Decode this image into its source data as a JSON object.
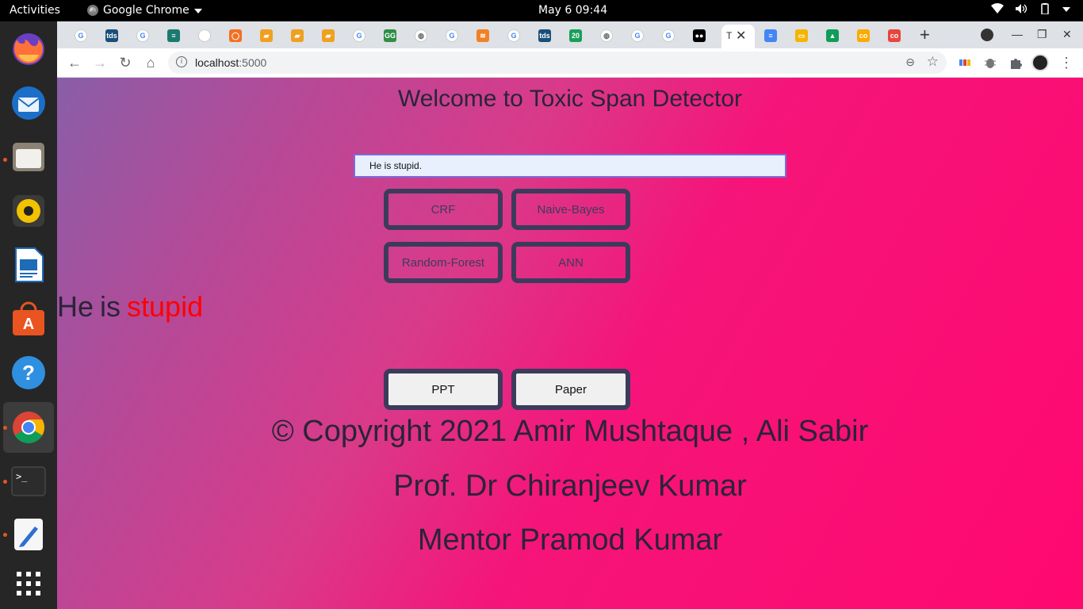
{
  "topbar": {
    "activities": "Activities",
    "app_name": "Google Chrome",
    "clock": "May 6  09:44"
  },
  "dock": {
    "items": [
      "firefox-icon",
      "thunderbird-icon",
      "files-icon",
      "rhythmbox-icon",
      "libreoffice-writer-icon",
      "software-icon",
      "help-icon",
      "chrome-icon",
      "terminal-icon",
      "text-editor-icon",
      "app-grid-icon"
    ]
  },
  "browser": {
    "tabs": [
      {
        "icon": "google",
        "color": "#4285f4",
        "label": "G"
      },
      {
        "icon": "tds",
        "color": "#1a4e7a",
        "label": "tds"
      },
      {
        "icon": "google",
        "color": "#4285f4",
        "label": "G"
      },
      {
        "icon": "table",
        "color": "#1a7a6e",
        "label": "≡"
      },
      {
        "icon": "wikipedia",
        "color": "#ffffff",
        "label": "W"
      },
      {
        "icon": "ring",
        "color": "#f37021",
        "label": "◯"
      },
      {
        "icon": "book",
        "color": "#f0a020",
        "label": "▰"
      },
      {
        "icon": "book",
        "color": "#f0a020",
        "label": "▰"
      },
      {
        "icon": "book",
        "color": "#f0a020",
        "label": "▰"
      },
      {
        "icon": "google",
        "color": "#4285f4",
        "label": "G"
      },
      {
        "icon": "gfg",
        "color": "#2f8d46",
        "label": "GG"
      },
      {
        "icon": "globe",
        "color": "#5f6368",
        "label": "◍"
      },
      {
        "icon": "google",
        "color": "#4285f4",
        "label": "G"
      },
      {
        "icon": "stack",
        "color": "#f48024",
        "label": "≋"
      },
      {
        "icon": "google",
        "color": "#4285f4",
        "label": "G"
      },
      {
        "icon": "tds",
        "color": "#1a4e7a",
        "label": "tds"
      },
      {
        "icon": "twenty",
        "color": "#18a058",
        "label": "20"
      },
      {
        "icon": "globe",
        "color": "#5f6368",
        "label": "◍"
      },
      {
        "icon": "google",
        "color": "#4285f4",
        "label": "G"
      },
      {
        "icon": "google",
        "color": "#4285f4",
        "label": "G"
      },
      {
        "icon": "medium",
        "color": "#000000",
        "label": "●●"
      }
    ],
    "active_tab_label": "T",
    "after_tabs": [
      {
        "icon": "docs",
        "color": "#4285f4",
        "label": "≡"
      },
      {
        "icon": "slides",
        "color": "#f4b400",
        "label": "▭"
      },
      {
        "icon": "drive",
        "color": "#0f9d58",
        "label": "▲"
      },
      {
        "icon": "colab",
        "color": "#f9ab00",
        "label": "co"
      },
      {
        "icon": "colab",
        "color": "#e8453c",
        "label": "co"
      }
    ],
    "url_host": "localhost",
    "url_port": ":5000"
  },
  "page": {
    "title": "Welcome to Toxic Span Detector",
    "input_value": "He is stupid.",
    "models": [
      "CRF",
      "Naive-Bayes",
      "Random-Forest",
      "ANN"
    ],
    "result_words": [
      "He",
      "is",
      "stupid"
    ],
    "result_toxic": [
      false,
      false,
      true
    ],
    "links": [
      "PPT",
      "Paper"
    ],
    "footer": {
      "copyright": "© Copyright 2021 Amir Mushtaque , Ali Sabir",
      "professor": "Prof. Dr Chiranjeev Kumar",
      "mentor": "Mentor Pramod Kumar"
    }
  }
}
